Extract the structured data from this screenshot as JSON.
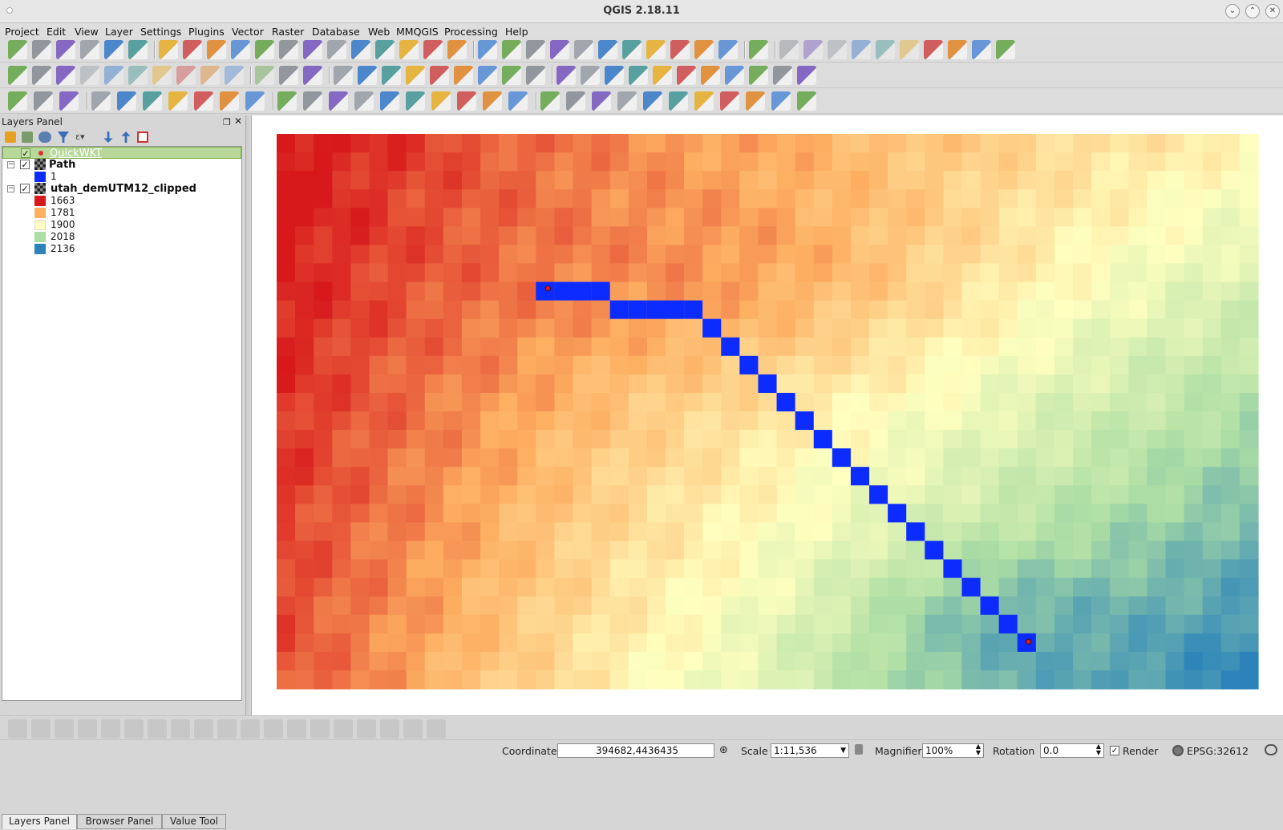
{
  "window": {
    "title": "QGIS 2.18.11"
  },
  "menu": [
    "Project",
    "Edit",
    "View",
    "Layer",
    "Settings",
    "Plugins",
    "Vector",
    "Raster",
    "Database",
    "Web",
    "MMQGIS",
    "Processing",
    "Help"
  ],
  "toolbar_icons": {
    "row1": [
      "new-project-icon",
      "open-project-icon",
      "save-project-icon",
      "save-as-icon",
      "print-composer-icon",
      "composer-manager-icon",
      "pan-icon",
      "pan-to-selection-icon",
      "zoom-in-icon",
      "zoom-out-icon",
      "zoom-native-icon",
      "zoom-full-icon",
      "zoom-to-selection-icon",
      "zoom-to-layer-icon",
      "zoom-last-icon",
      "zoom-next-icon",
      "new-bookmark-icon",
      "show-bookmarks-icon",
      "refresh-icon",
      "identify-icon",
      "run-action-icon",
      "select-features-icon",
      "select-by-expression-icon",
      "deselect-icon",
      "attribute-table-icon",
      "field-calculator-icon",
      "statistics-icon",
      "measure-icon",
      "map-tips-icon",
      "text-annotation-icon",
      "help-icon",
      "move-label-icon",
      "rotate-label-icon",
      "change-label-icon",
      "pin-labels-icon",
      "show-labels-icon",
      "highlight-pinned-icon",
      "grid-icon",
      "sun-icon",
      "metasearch-icon",
      "sigma-icon"
    ],
    "row2": [
      "current-edits-icon",
      "toggle-editing-icon",
      "save-layer-edits-icon",
      "add-feature-icon",
      "move-feature-icon",
      "node-tool-icon",
      "delete-selected-icon",
      "cut-features-icon",
      "copy-features-icon",
      "paste-features-icon",
      "label-tool-icon",
      "diagram-tool-icon",
      "layer-labeling-icon",
      "python-console-icon",
      "rasterize-icon",
      "pencil-icon",
      "comment-icon",
      "info-icon",
      "wkt-icon",
      "undo-icon",
      "area-icon",
      "quickwkt-icon",
      "add-vector-icon",
      "add-raster-icon",
      "add-wms-icon",
      "add-postgis-icon",
      "new-spatialite-icon",
      "wms-icon",
      "wcs-icon",
      "wfs-icon",
      "add-virtual-icon",
      "layer-style-icon",
      "gps-icon"
    ],
    "row3": [
      "magnifier-icon",
      "gear-icon",
      "search-icon",
      "profile-icon",
      "sky-icon",
      "grid-tool-icon",
      "scatter-icon",
      "spiral-icon",
      "process-icon",
      "leaf-icon",
      "histogram-icon",
      "lat-long-icon",
      "raster-grid-icon",
      "mouse-icon",
      "flag-icon",
      "leaf-green-icon",
      "hammer-icon",
      "chest-icon",
      "pen-icon",
      "film-icon",
      "pixels-icon",
      "image-icon",
      "apple-icon",
      "terrain-icon",
      "profile-tool-icon",
      "zoom-find-icon",
      "leaf-yellow-icon",
      "curve-icon",
      "plane-icon",
      "tool-icon",
      "image-viewer-icon"
    ]
  },
  "layers_panel": {
    "title": "Layers Panel",
    "layers": [
      {
        "name": "QuickWKT",
        "checked": true,
        "selected": true
      },
      {
        "name": "Path",
        "checked": true,
        "legend": [
          {
            "label": "1",
            "color": "#0b2bff"
          }
        ]
      },
      {
        "name": "utah_demUTM12_clipped",
        "checked": true,
        "legend": [
          {
            "label": "1663",
            "color": "#d7191c"
          },
          {
            "label": "1781",
            "color": "#fdae61"
          },
          {
            "label": "1900",
            "color": "#ffffbf"
          },
          {
            "label": "2018",
            "color": "#abdda4"
          },
          {
            "label": "2136",
            "color": "#2b83ba"
          }
        ]
      }
    ]
  },
  "bottom_tabs": [
    "Layers Panel",
    "Browser Panel",
    "Value Tool"
  ],
  "map": {
    "grid_cols": 53,
    "grid_rows": 30,
    "path_cells": [
      [
        14,
        8
      ],
      [
        15,
        8
      ],
      [
        16,
        8
      ],
      [
        17,
        8
      ],
      [
        18,
        9
      ],
      [
        19,
        9
      ],
      [
        20,
        9
      ],
      [
        21,
        9
      ],
      [
        22,
        9
      ],
      [
        23,
        10
      ],
      [
        24,
        11
      ],
      [
        25,
        12
      ],
      [
        26,
        13
      ],
      [
        27,
        14
      ],
      [
        28,
        15
      ],
      [
        29,
        16
      ],
      [
        30,
        17
      ],
      [
        31,
        18
      ],
      [
        32,
        19
      ],
      [
        33,
        20
      ],
      [
        34,
        21
      ],
      [
        35,
        22
      ],
      [
        36,
        23
      ],
      [
        37,
        24
      ],
      [
        38,
        25
      ],
      [
        39,
        26
      ],
      [
        40,
        27
      ]
    ],
    "start_point": [
      14.65,
      8.35
    ],
    "end_point": [
      40.6,
      27.45
    ]
  },
  "status": {
    "coordinate_label": "Coordinate",
    "coordinate": "394682,4436435",
    "scale_label": "Scale",
    "scale": "1:11,536",
    "magnifier_label": "Magnifier",
    "magnifier": "100%",
    "rotation_label": "Rotation",
    "rotation": "0.0",
    "render_label": "Render",
    "crs": "EPSG:32612"
  }
}
